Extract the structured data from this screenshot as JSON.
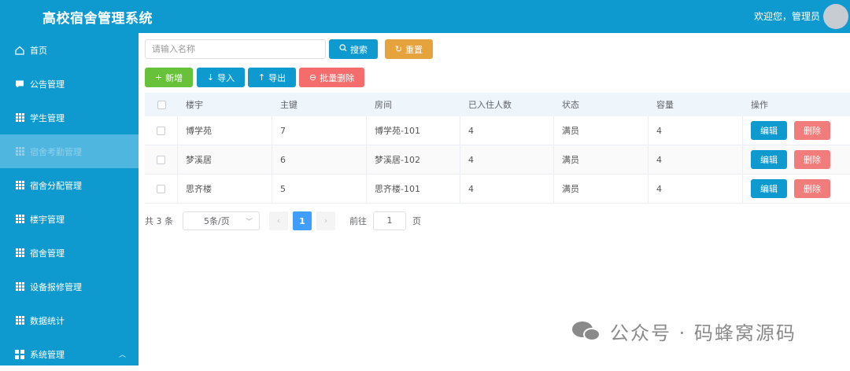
{
  "header": {
    "title": "高校宿舍管理系统",
    "welcome": "欢迎您，管理员"
  },
  "sidebar": {
    "items": [
      {
        "label": "首页",
        "icon": "home-icon"
      },
      {
        "label": "公告管理",
        "icon": "message-icon"
      },
      {
        "label": "学生管理",
        "icon": "grid-icon"
      },
      {
        "label": "宿舍考勤管理",
        "icon": "grid-icon",
        "active": true
      },
      {
        "label": "宿舍分配管理",
        "icon": "grid-icon"
      },
      {
        "label": "楼宇管理",
        "icon": "grid-icon"
      },
      {
        "label": "宿舍管理",
        "icon": "grid-icon"
      },
      {
        "label": "设备报修管理",
        "icon": "grid-icon"
      },
      {
        "label": "数据统计",
        "icon": "grid-icon"
      },
      {
        "label": "系统管理",
        "icon": "apps-icon"
      }
    ]
  },
  "search": {
    "placeholder": "请输入名称",
    "search_label": "搜索",
    "reset_label": "重置"
  },
  "toolbar": {
    "add_label": "新增",
    "import_label": "导入",
    "export_label": "导出",
    "bulk_delete_label": "批量删除"
  },
  "table": {
    "columns": [
      "楼宇",
      "主键",
      "房间",
      "已入住人数",
      "状态",
      "容量",
      "操作"
    ],
    "rows": [
      {
        "building": "博学苑",
        "id": "7",
        "room": "博学苑-101",
        "occupants": "4",
        "status": "满员",
        "capacity": "4"
      },
      {
        "building": "梦溪居",
        "id": "6",
        "room": "梦溪居-102",
        "occupants": "4",
        "status": "满员",
        "capacity": "4"
      },
      {
        "building": "思齐楼",
        "id": "5",
        "room": "思齐楼-101",
        "occupants": "4",
        "status": "满员",
        "capacity": "4"
      }
    ],
    "edit_label": "编辑",
    "delete_label": "删除"
  },
  "pagination": {
    "total": "共 3 条",
    "page_size": "5条/页",
    "current_page": "1",
    "goto_label": "前往",
    "goto_value": "1",
    "page_label": "页"
  },
  "watermark": {
    "text": "公众号 · 码蜂窝源码"
  },
  "colors": {
    "primary": "#0e9acf",
    "success": "#67c23a",
    "warning": "#e6a23c",
    "danger": "#f56c6c",
    "page_active": "#409eff"
  }
}
